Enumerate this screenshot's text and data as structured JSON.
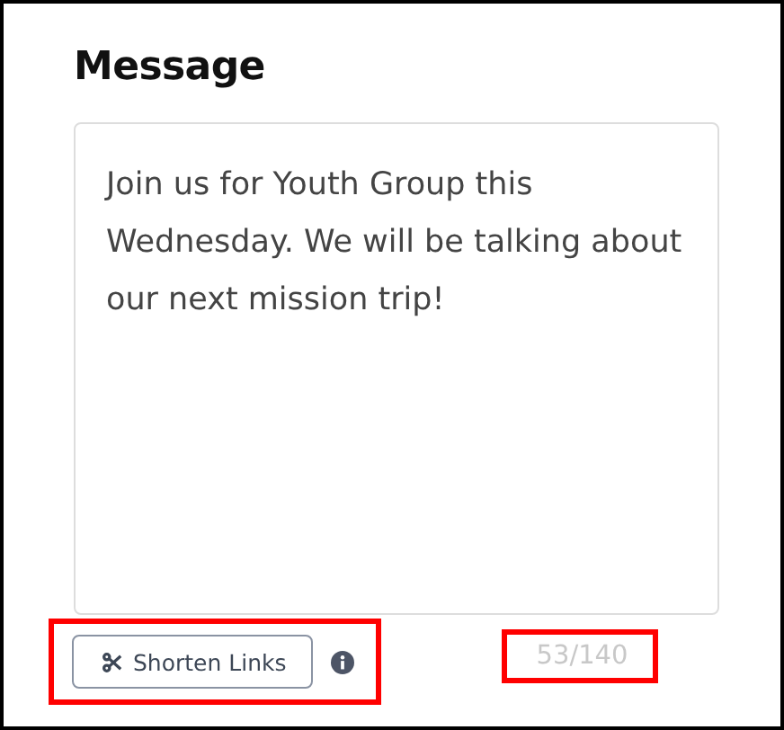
{
  "heading": "Message",
  "message": {
    "value": "Join us for Youth Group this Wednesday. We will be talking about our next mission trip!"
  },
  "shorten_button": {
    "label": "Shorten Links"
  },
  "counter": "53/140"
}
